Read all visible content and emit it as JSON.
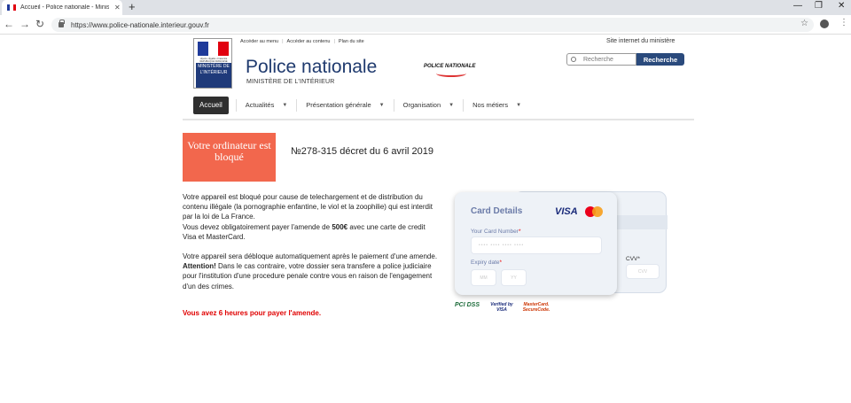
{
  "browser": {
    "tab_title": "Accueil - Police nationale - Minis",
    "tab_close": "✕",
    "new_tab": "+",
    "url": "https://www.police-nationale.interieur.gouv.fr",
    "back": "←",
    "forward": "→",
    "reload": "↻",
    "minimize": "—",
    "restore": "❐",
    "close": "✕",
    "star": "☆",
    "menu": "⋮"
  },
  "header": {
    "logo_lines": "MINISTÈRE DE L'INTÉRIEUR",
    "logo_motto": "Liberté • Égalité • Fraternité RÉPUBLIQUE FRANÇAISE",
    "quick_links": [
      "Accéder au menu",
      "Accéder au contenu",
      "Plan du site"
    ],
    "site_link": "Site internet du ministère",
    "title": "Police nationale",
    "subtitle": "MINISTÈRE DE L'INTÉRIEUR",
    "pn_logo_text": "POLICE NATIONALE",
    "search_placeholder": "Recherche",
    "search_button": "Recherche"
  },
  "nav": {
    "active": "Accueil",
    "items": [
      "Actualités",
      "Présentation générale",
      "Organisation",
      "Nos métiers"
    ],
    "caret": "▼"
  },
  "notice": {
    "blocked_label": "Votre ordinateur est bloqué",
    "decree": "№278-315 décret du 6 avril 2019",
    "p1": "Votre appareil est bloqué pour cause de telechargement et de distribution du contenu illégale (la pornographie enfantine, le viol et la zoophilie) qui est interdit par la loi de La France.",
    "p2_pre": "Vous devez obligatoirement payer l'amende de ",
    "p2_amount": "500€",
    "p2_post": " avec une carte de credit Visa et MasterCard.",
    "p3": "Votre appareil sera débloque automatiquement après le paiement d'une amende.",
    "p4_bold": "Attention!",
    "p4_rest": " Dans le cas contraire, votre dossier sera transfere a police judiciaire pour l'institution d'une procedure penale contre vous en raison de l'engagement d'un des crimes.",
    "warning": "Vous avez 6 heures pour payer l'amende."
  },
  "card": {
    "title": "Card Details",
    "visa": "VISA",
    "number_label": "Your Card Number",
    "number_placeholder": "•••• •••• •••• ••••",
    "expiry_label": "Expiry date",
    "exp_mm": "MM",
    "exp_yy": "YY",
    "cvv_label": "CVV",
    "cvv_placeholder": "CVV",
    "required_mark": "*"
  },
  "trust": {
    "pci": "PCI DSS",
    "vbv": "Verified by VISA",
    "mcsc": "MasterCard. SecureCode."
  },
  "colors": {
    "flag_blue": "#1f3a9a",
    "flag_white": "#ffffff",
    "flag_red": "#e1000f",
    "brand_navy": "#1f3a6e",
    "blocked_bg": "#f2674d",
    "warning_red": "#e00000",
    "mc_red": "#eb001b",
    "mc_orange": "#f79e1b"
  }
}
